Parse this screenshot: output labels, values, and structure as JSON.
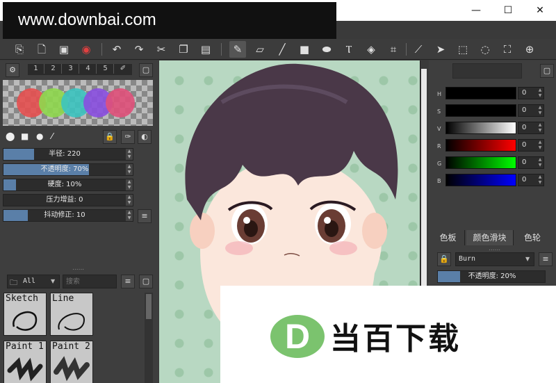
{
  "watermark": "www.downbai.com",
  "window": {
    "minimize": "—",
    "maximize": "☐",
    "close": "✕"
  },
  "brush_tabs": [
    "1",
    "2",
    "3",
    "4",
    "5"
  ],
  "swatch_colors": [
    "#e55050",
    "#8fd84e",
    "#3cc4c0",
    "#8a4fe0",
    "#e0507a"
  ],
  "sliders": [
    {
      "label": "半径: 220",
      "value": 0.25
    },
    {
      "label": "不透明度: 70%",
      "value": 0.7
    },
    {
      "label": "硬度: 10%",
      "value": 0.1
    },
    {
      "label": "压力增益: 0",
      "value": 0.0
    },
    {
      "label": "抖动修正: 10",
      "value": 0.2
    }
  ],
  "brush_filter": "All",
  "brush_search_placeholder": "搜索",
  "brushes": [
    "Sketch",
    "Line",
    "Paint 1",
    "Paint 2"
  ],
  "channels": [
    {
      "label": "H",
      "value": "0",
      "gradient": "linear-gradient(90deg,#000,#000)"
    },
    {
      "label": "S",
      "value": "0",
      "gradient": "linear-gradient(90deg,#000,#000)"
    },
    {
      "label": "V",
      "value": "0",
      "gradient": "linear-gradient(90deg,#000,#fff)"
    },
    {
      "label": "R",
      "value": "0",
      "gradient": "linear-gradient(90deg,#000,#f00)"
    },
    {
      "label": "G",
      "value": "0",
      "gradient": "linear-gradient(90deg,#000,#0f0)"
    },
    {
      "label": "B",
      "value": "0",
      "gradient": "linear-gradient(90deg,#000,#00f)"
    }
  ],
  "color_tabs": [
    "色板",
    "颜色滑块",
    "色轮"
  ],
  "layer_blend_mode": "Burn",
  "layer_opacity": "不透明度: 20%",
  "ad": {
    "logo_letter": "D",
    "text": "当百下载"
  }
}
